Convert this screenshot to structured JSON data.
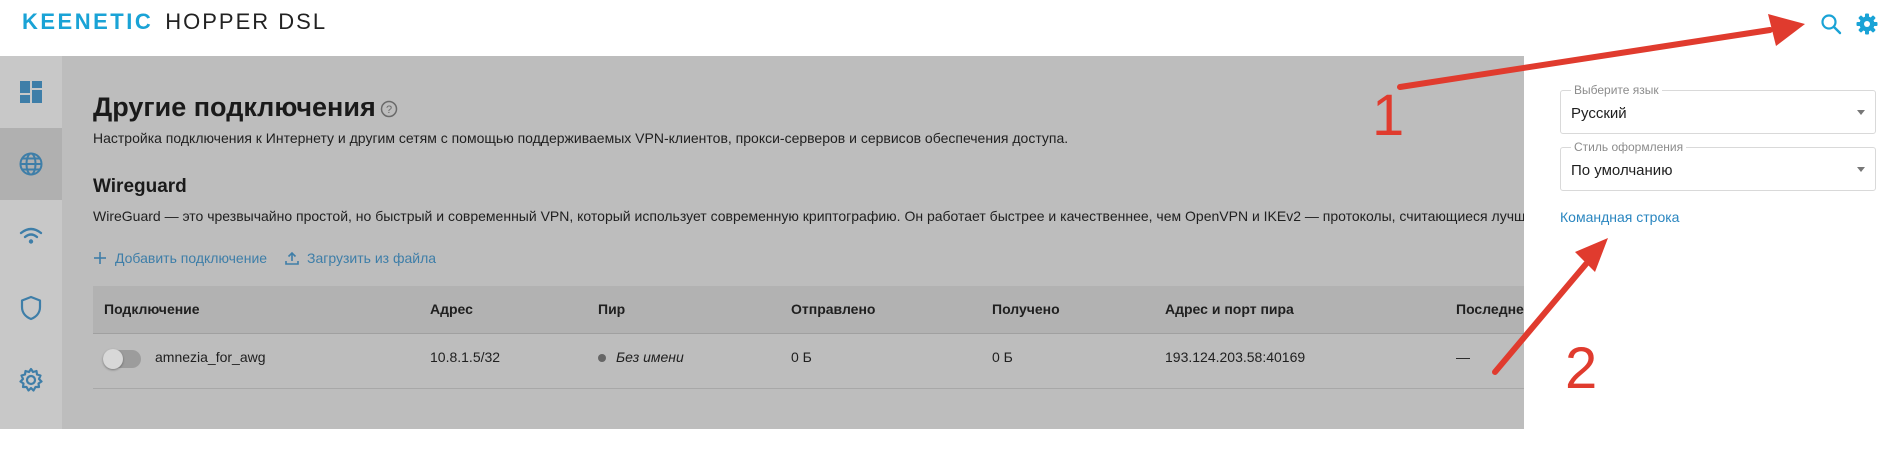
{
  "app": {
    "brand": "KEENETIC",
    "model": "HOPPER DSL"
  },
  "header": {
    "icons": [
      "search-icon",
      "gear-icon"
    ]
  },
  "sidebar": {
    "items": [
      {
        "icon": "dashboard-icon"
      },
      {
        "icon": "globe-icon",
        "active": true
      },
      {
        "icon": "wifi-icon"
      },
      {
        "icon": "shield-icon"
      },
      {
        "icon": "gear-icon"
      }
    ]
  },
  "main": {
    "title": "Другие подключения",
    "description": "Настройка подключения к Интернету и другим сетям с помощью поддерживаемых VPN-клиентов, прокси-серверов и сервисов обеспечения доступа.",
    "section": {
      "title": "Wireguard",
      "description": "WireGuard — это чрезвычайно простой, но быстрый и современный VPN, который использует современную криптографию. Он работает быстрее и качественнее, чем OpenVPN и IKEv2 — протоколы, считающиеся лучш"
    },
    "actions": {
      "add": "Добавить подключение",
      "upload": "Загрузить из файла"
    },
    "table": {
      "columns": [
        "Подключение",
        "Адрес",
        "Пир",
        "Отправлено",
        "Получено",
        "Адрес и порт пира",
        "Последне"
      ],
      "rows": [
        {
          "enabled": false,
          "name": "amnezia_for_awg",
          "address": "10.8.1.5/32",
          "peer": "Без имени",
          "sent": "0 Б",
          "received": "0 Б",
          "peer_endpoint": "193.124.203.58:40169",
          "last": "—"
        }
      ]
    }
  },
  "panel": {
    "language": {
      "label": "Выберите язык",
      "value": "Русский"
    },
    "theme": {
      "label": "Стиль оформления",
      "value": "По умолчанию"
    },
    "cmd_link": "Командная строка"
  },
  "annotations": {
    "label1": "1",
    "label2": "2",
    "color": "#e03b2e"
  },
  "colors": {
    "accent": "#1aa3d6",
    "link": "#2a86c0",
    "overlay": "#bdbdbd"
  }
}
